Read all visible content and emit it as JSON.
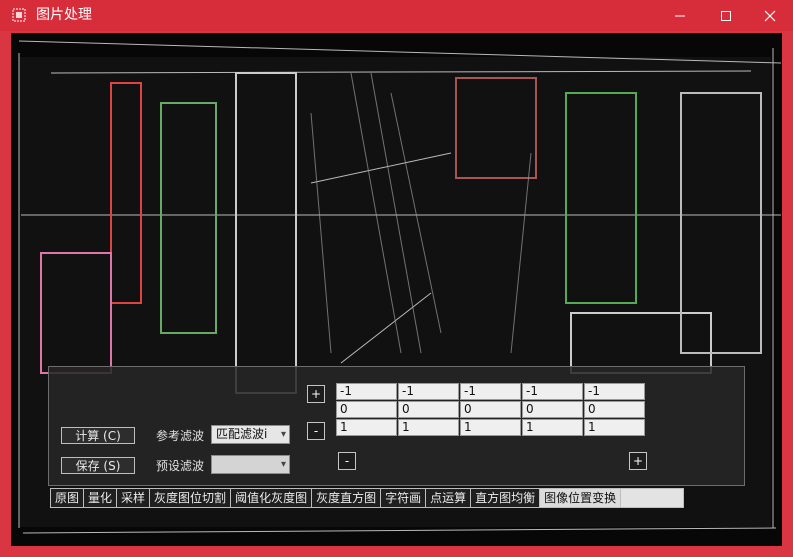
{
  "window": {
    "title": "图片处理",
    "icon": "app-icon",
    "controls": {
      "minimize": "–",
      "maximize": "☐",
      "close": "✕"
    }
  },
  "image": {
    "description_icon": "edge-filtered-image"
  },
  "panel": {
    "compute_button": "计算 (C)",
    "save_button": "保存 (S)",
    "reference_filter_label": "参考滤波",
    "reference_filter_value": "匹配滤波i",
    "preset_filter_label": "预设滤波",
    "preset_filter_value": "",
    "add_row": "+",
    "remove_row": "-",
    "remove_col": "-",
    "add_col": "+",
    "kernel": [
      [
        "-1",
        "-1",
        "-1",
        "-1",
        "-1"
      ],
      [
        "0",
        "0",
        "0",
        "0",
        "0"
      ],
      [
        "1",
        "1",
        "1",
        "1",
        "1"
      ]
    ]
  },
  "tabs": [
    "原图",
    "量化",
    "采样",
    "灰度图位切割",
    "阈值化灰度图",
    "灰度直方图",
    "字符画",
    "点运算",
    "直方图均衡",
    "图像位置变换"
  ],
  "active_tab_index": 9,
  "colors": {
    "titlebar": "#d72c3a",
    "panel": "#262626",
    "canvas": "#060606"
  }
}
